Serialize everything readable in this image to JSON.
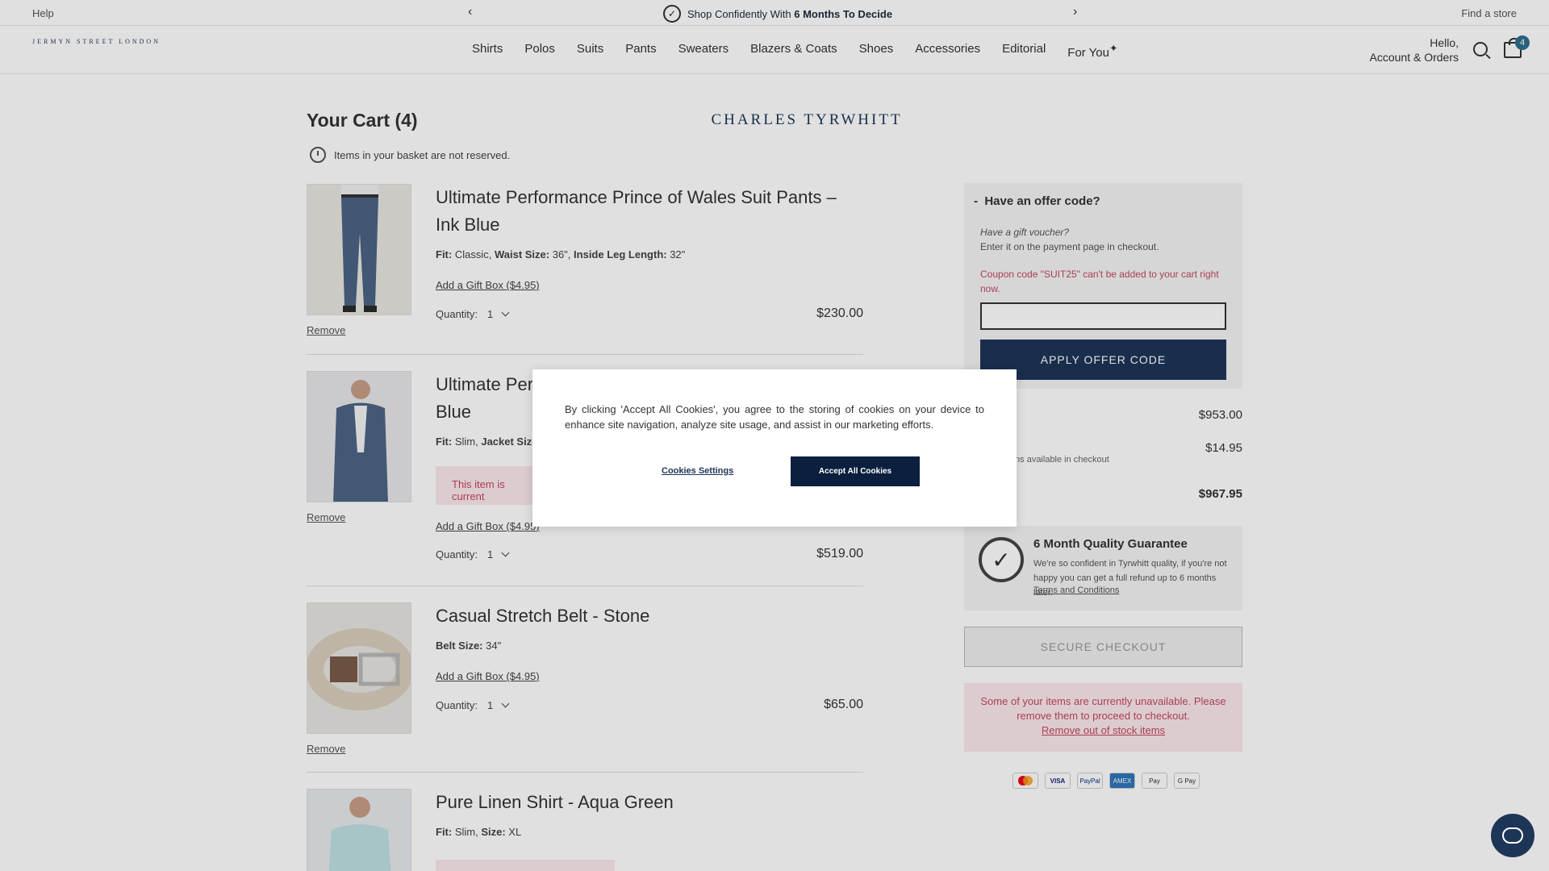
{
  "topbar": {
    "help": "Help",
    "promo_prefix": "Shop Confidently With ",
    "promo_bold": "6 Months To Decide",
    "find_store": "Find a store"
  },
  "header": {
    "logo_main": "CHARLES TYRWHITT",
    "logo_sub": "JERMYN STREET LONDON",
    "nav": [
      "Shirts",
      "Polos",
      "Suits",
      "Pants",
      "Sweaters",
      "Blazers & Coats",
      "Shoes",
      "Accessories",
      "Editorial",
      "For You"
    ],
    "greeting": "Hello,",
    "account": "Account & Orders",
    "cart_count": "4"
  },
  "cart": {
    "title": "Your Cart (4)",
    "reserve_note": "Items in your basket are not reserved.",
    "remove_label": "Remove",
    "gift_label": "Add a Gift Box ($4.95)",
    "qty_label": "Quantity:",
    "items": [
      {
        "name": "Ultimate Performance Prince of Wales Suit Pants – Ink Blue",
        "spec1_k": "Fit:",
        "spec1_v": " Classic, ",
        "spec2_k": "Waist Size:",
        "spec2_v": " 36\", ",
        "spec3_k": "Inside Leg Length:",
        "spec3_v": " 32\"",
        "qty": "1",
        "price": "$230.00"
      },
      {
        "name": "Ultimate Perfo",
        "name_line2": "Blue",
        "spec1_k": "Fit:",
        "spec1_v": " Slim, ",
        "spec2_k": "Jacket Size:",
        "spec2_v": " 3",
        "warning": "This item is current",
        "qty": "1",
        "price": "$519.00"
      },
      {
        "name": "Casual Stretch Belt - Stone",
        "spec1_k": "Belt Size:",
        "spec1_v": " 34\"",
        "qty": "1",
        "price": "$65.00"
      },
      {
        "name": "Pure Linen Shirt - Aqua Green",
        "spec1_k": "Fit:",
        "spec1_v": " Slim, ",
        "spec2_k": "Size:",
        "spec2_v": " XL"
      }
    ]
  },
  "offer": {
    "heading": "Have an offer code?",
    "toggle": "-",
    "gift_voucher": "Have a gift voucher?",
    "gift_note": "Enter it on the payment page in checkout.",
    "error": "Coupon code \"SUIT25\" can't be added to your cart right now.",
    "input_value": "",
    "apply": "APPLY OFFER CODE"
  },
  "summary": {
    "subtotal": "$953.00",
    "shipping_label": "ping",
    "shipping_sub": "g options available in checkout",
    "shipping": "$14.95",
    "total": "$967.95"
  },
  "guarantee": {
    "title": "6 Month Quality Guarantee",
    "body": "We're so confident in Tyrwhitt quality, if you're not happy you can get a full refund up to 6 months later.",
    "link": "Terms and Conditions"
  },
  "checkout": {
    "button": "SECURE CHECKOUT",
    "oos_text": "Some of your items are currently unavailable. Please remove them to proceed to checkout.",
    "oos_link": "Remove out of stock items"
  },
  "payments": [
    "",
    "VISA",
    "PayPal",
    "AMEX",
    "Pay",
    "G Pay"
  ],
  "cookie": {
    "text": "By clicking 'Accept All Cookies', you agree to the storing of cookies on your device to enhance site navigation, analyze site usage, and assist in our marketing efforts.",
    "settings": "Cookies Settings",
    "accept": "Accept All Cookies"
  },
  "colors": {
    "brand": "#1d3557",
    "error": "#c3475f",
    "warning_bg": "#fbe9ec"
  }
}
